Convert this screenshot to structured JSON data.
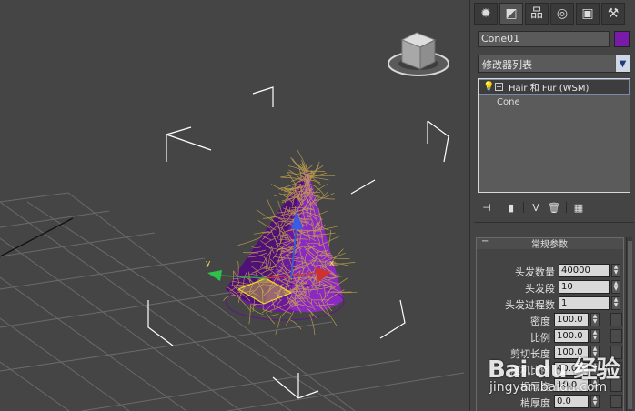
{
  "viewport": {
    "axis_labels": {
      "y": "y",
      "x": "x"
    }
  },
  "command_panel": {
    "tabs": [
      {
        "icon": "sun-icon",
        "glyph": "✹"
      },
      {
        "icon": "modify-icon",
        "glyph": "◩"
      },
      {
        "icon": "hierarchy-icon",
        "glyph": "品"
      },
      {
        "icon": "motion-icon",
        "glyph": "◎"
      },
      {
        "icon": "display-icon",
        "glyph": "▣"
      },
      {
        "icon": "utilities-icon",
        "glyph": "⚒"
      }
    ],
    "object_name": "Cone01",
    "object_color": "#7a1aa8",
    "modifier_list_label": "修改器列表",
    "stack": [
      {
        "label": "Hair 和 Fur (WSM)",
        "selected": true
      },
      {
        "label": "Cone",
        "selected": false
      }
    ],
    "stack_buttons": [
      {
        "icon": "pin-stack-icon",
        "glyph": "⊣"
      },
      {
        "icon": "show-end-result-icon",
        "glyph": "▮"
      },
      {
        "icon": "make-unique-icon",
        "glyph": "∀"
      },
      {
        "icon": "remove-modifier-icon",
        "glyph": "🗑"
      },
      {
        "icon": "configure-sets-icon",
        "glyph": "▦"
      }
    ],
    "rollout": {
      "title": "常规参数",
      "collapse_glyph": "−",
      "params": [
        {
          "label": "头发数量",
          "value": "40000"
        },
        {
          "label": "头发段",
          "value": "10"
        },
        {
          "label": "头发过程数",
          "value": "1"
        },
        {
          "label": "密度",
          "value": "100.0"
        },
        {
          "label": "比例",
          "value": "100.0"
        },
        {
          "label": "剪切长度",
          "value": "100.0"
        },
        {
          "label": "随机比例",
          "value": "40.0"
        },
        {
          "label": "根厚度",
          "value": "10.0"
        },
        {
          "label": "梢厚度",
          "value": "0.0"
        }
      ]
    }
  },
  "watermark": {
    "logo": "Bai du 经验",
    "url": "jingyan.baidu.com"
  }
}
